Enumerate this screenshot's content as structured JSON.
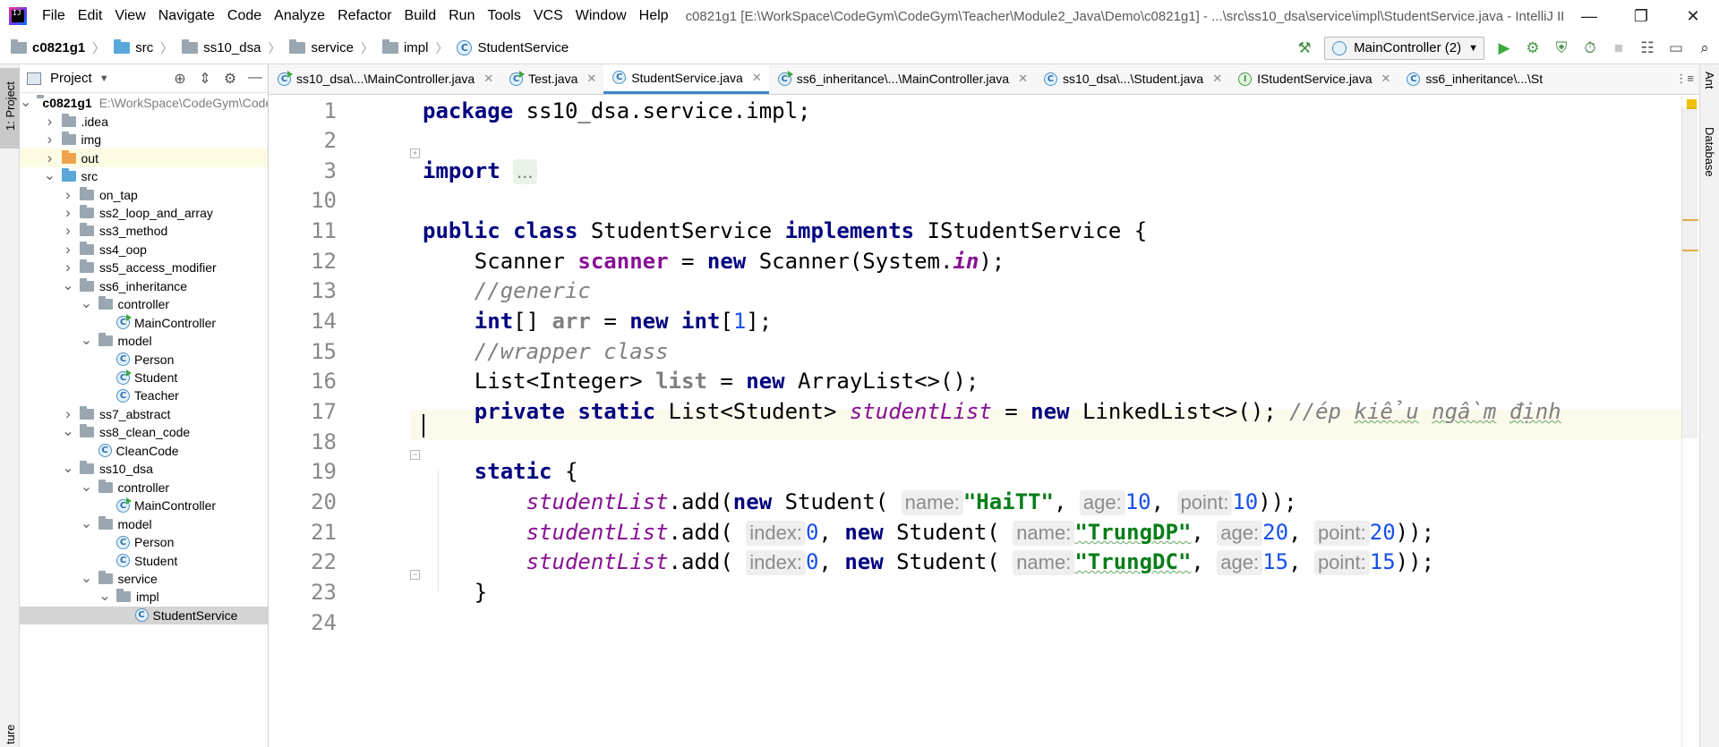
{
  "window": {
    "title": "c0821g1 [E:\\WorkSpace\\CodeGym\\CodeGym\\Teacher\\Module2_Java\\Demo\\c0821g1] - ...\\src\\ss10_dsa\\service\\impl\\StudentService.java - IntelliJ IDEA",
    "minimize": "—",
    "restore": "❐",
    "close": "✕"
  },
  "menu": [
    "File",
    "Edit",
    "View",
    "Navigate",
    "Code",
    "Analyze",
    "Refactor",
    "Build",
    "Run",
    "Tools",
    "VCS",
    "Window",
    "Help"
  ],
  "breadcrumb": [
    "c0821g1",
    "src",
    "ss10_dsa",
    "service",
    "impl",
    "StudentService"
  ],
  "toolbar": {
    "run_config": "MainController (2)",
    "build_icon": "hammer-icon",
    "run_icon": "▶",
    "debug_icon": "⚙",
    "coverage_icon": "⛨",
    "profile_icon": "⏱",
    "stop_icon": "■",
    "project_structure_icon": "☷",
    "search_icon": "⌕"
  },
  "left_stripe": {
    "project_tab": "1: Project",
    "structure_tab": "ture"
  },
  "right_stripe": {
    "ant_tab": "Ant",
    "database_tab": "Database"
  },
  "project_panel": {
    "title": "Project",
    "tree": [
      {
        "label": "c0821g1",
        "path": "E:\\WorkSpace\\CodeGym\\CodeGym",
        "depth": 0,
        "arrow": "open",
        "icon": "module-folder",
        "bold": true
      },
      {
        "label": ".idea",
        "depth": 1,
        "arrow": "closed",
        "icon": "folder"
      },
      {
        "label": "img",
        "depth": 1,
        "arrow": "closed",
        "icon": "folder"
      },
      {
        "label": "out",
        "depth": 1,
        "arrow": "closed",
        "icon": "folder-orange"
      },
      {
        "label": "src",
        "depth": 1,
        "arrow": "open",
        "icon": "folder-blue"
      },
      {
        "label": "on_tap",
        "depth": 2,
        "arrow": "closed",
        "icon": "package"
      },
      {
        "label": "ss2_loop_and_array",
        "depth": 2,
        "arrow": "closed",
        "icon": "package"
      },
      {
        "label": "ss3_method",
        "depth": 2,
        "arrow": "closed",
        "icon": "package"
      },
      {
        "label": "ss4_oop",
        "depth": 2,
        "arrow": "closed",
        "icon": "package"
      },
      {
        "label": "ss5_access_modifier",
        "depth": 2,
        "arrow": "closed",
        "icon": "package"
      },
      {
        "label": "ss6_inheritance",
        "depth": 2,
        "arrow": "open",
        "icon": "package"
      },
      {
        "label": "controller",
        "depth": 3,
        "arrow": "open",
        "icon": "package"
      },
      {
        "label": "MainController",
        "depth": 4,
        "arrow": "none",
        "icon": "class-run"
      },
      {
        "label": "model",
        "depth": 3,
        "arrow": "open",
        "icon": "package"
      },
      {
        "label": "Person",
        "depth": 4,
        "arrow": "none",
        "icon": "class"
      },
      {
        "label": "Student",
        "depth": 4,
        "arrow": "none",
        "icon": "class-run"
      },
      {
        "label": "Teacher",
        "depth": 4,
        "arrow": "none",
        "icon": "class"
      },
      {
        "label": "ss7_abstract",
        "depth": 2,
        "arrow": "closed",
        "icon": "package"
      },
      {
        "label": "ss8_clean_code",
        "depth": 2,
        "arrow": "open",
        "icon": "package"
      },
      {
        "label": "CleanCode",
        "depth": 3,
        "arrow": "none",
        "icon": "class"
      },
      {
        "label": "ss10_dsa",
        "depth": 2,
        "arrow": "open",
        "icon": "package"
      },
      {
        "label": "controller",
        "depth": 3,
        "arrow": "open",
        "icon": "package"
      },
      {
        "label": "MainController",
        "depth": 4,
        "arrow": "none",
        "icon": "class-run"
      },
      {
        "label": "model",
        "depth": 3,
        "arrow": "open",
        "icon": "package"
      },
      {
        "label": "Person",
        "depth": 4,
        "arrow": "none",
        "icon": "class"
      },
      {
        "label": "Student",
        "depth": 4,
        "arrow": "none",
        "icon": "class"
      },
      {
        "label": "service",
        "depth": 3,
        "arrow": "open",
        "icon": "package"
      },
      {
        "label": "impl",
        "depth": 4,
        "arrow": "open",
        "icon": "package"
      },
      {
        "label": "StudentService",
        "depth": 5,
        "arrow": "none",
        "icon": "class",
        "selected": true
      }
    ]
  },
  "editor_tabs": [
    {
      "label": "ss10_dsa\\...\\MainController.java",
      "icon": "class-run",
      "active": false
    },
    {
      "label": "Test.java",
      "icon": "class-run",
      "active": false
    },
    {
      "label": "StudentService.java",
      "icon": "class",
      "active": true
    },
    {
      "label": "ss6_inheritance\\...\\MainController.java",
      "icon": "class-run",
      "active": false
    },
    {
      "label": "ss10_dsa\\...\\Student.java",
      "icon": "class",
      "active": false
    },
    {
      "label": "IStudentService.java",
      "icon": "interface",
      "active": false
    },
    {
      "label": "ss6_inheritance\\...\\St",
      "icon": "class",
      "active": false
    }
  ],
  "tabs_more": "⋮≡",
  "editor": {
    "line_numbers": [
      "1",
      "2",
      "3",
      "10",
      "11",
      "12",
      "13",
      "14",
      "15",
      "16",
      "17",
      "18",
      "19",
      "20",
      "21",
      "22",
      "23",
      "24"
    ],
    "current_line": "18",
    "code": {
      "l1": {
        "kw": "package",
        "rest": " ss10_dsa.service.impl;"
      },
      "l3": {
        "kw": "import",
        "fold": "..."
      },
      "l11": {
        "kw1": "public",
        "kw2": "class",
        "name": " StudentService ",
        "kw3": "implements",
        "rest": " IStudentService {"
      },
      "l12": {
        "type": "    Scanner ",
        "field": "scanner",
        "eq": " = ",
        "kw": "new",
        "call": " Scanner(System.",
        "static": "in",
        "end": ");"
      },
      "l13": {
        "comment": "    //generic"
      },
      "l14": {
        "kw1": "    int",
        "a": "[] ",
        "field": "arr",
        "eq": " = ",
        "kw2": "new",
        "kw3": " int",
        "b": "[",
        "num": "1",
        "c": "];"
      },
      "l15": {
        "comment": "    //wrapper class"
      },
      "l16": {
        "type": "    List<Integer> ",
        "field": "list",
        "eq": " = ",
        "kw": "new",
        "rest": " ArrayList<>();"
      },
      "l17": {
        "kw1": "    private",
        "kw2": " static",
        "type": " List<Student> ",
        "field": "studentList",
        "eq": " = ",
        "kw3": "new",
        "rest": " LinkedList<>(); ",
        "comment_a": "//ép ",
        "comment_b": "kiểu",
        " comment_c": " ",
        "comment_d": "ngầm",
        "comment_e": " ",
        "comment_f": "định"
      },
      "l19": {
        "kw": "    static",
        "rest": " {"
      },
      "l20": {
        "field": "        studentList",
        "a": ".add(",
        "kw": "new",
        "b": " Student( ",
        "h1": "name:",
        "s1": "\"HaiTT\"",
        "c": ", ",
        "h2": "age:",
        "n1": "10",
        "d": ", ",
        "h3": "point:",
        "n2": "10",
        "e": "));"
      },
      "l21": {
        "field": "        studentList",
        "a": ".add( ",
        "h0": "index:",
        "n0": "0",
        "b": ", ",
        "kw": "new",
        "c": " Student( ",
        "h1": "name:",
        "s1": "\"TrungDP\"",
        "d": ", ",
        "h2": "age:",
        "n1": "20",
        "e": ", ",
        "h3": "point:",
        "n2": "20",
        "f": "));"
      },
      "l22": {
        "field": "        studentList",
        "a": ".add( ",
        "h0": "index:",
        "n0": "0",
        "b": ", ",
        "kw": "new",
        "c": " Student( ",
        "h1": "name:",
        "s1": "\"TrungDC\"",
        "d": ", ",
        "h2": "age:",
        "n1": "15",
        "e": ", ",
        "h3": "point:",
        "n2": "15",
        "f": "));"
      },
      "l23": {
        "rest": "    }"
      }
    }
  },
  "colors": {
    "keyword": "#000080",
    "string": "#067d17",
    "number": "#1750eb",
    "field": "#871094",
    "comment": "#808080",
    "current_line": "#fcfaed",
    "tab_underline": "#4083c9",
    "selection": "#d5d5d5"
  }
}
